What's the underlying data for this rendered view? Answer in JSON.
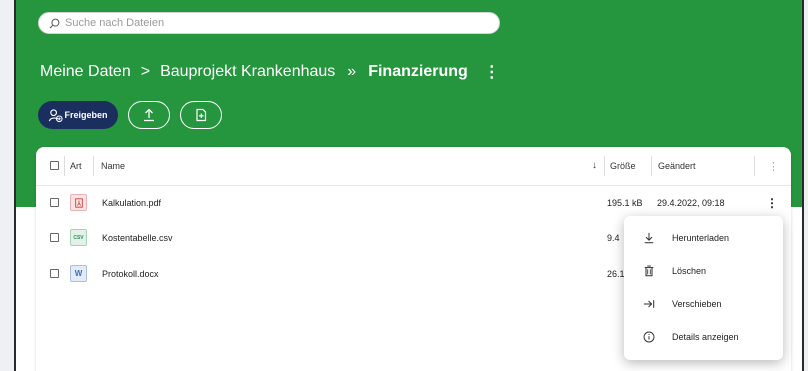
{
  "search": {
    "placeholder": "Suche nach Dateien"
  },
  "breadcrumb": {
    "root": "Meine Daten",
    "sep1": ">",
    "project": "Bauprojekt Krankenhaus",
    "sep2": "»",
    "current": "Finanzierung",
    "more": "⋮"
  },
  "toolbar": {
    "share_label": "Freigeben"
  },
  "table": {
    "columns": {
      "type": "Art",
      "name": "Name",
      "sort_arrow": "↓",
      "size": "Größe",
      "modified": "Geändert",
      "more": "⋮"
    },
    "rows": [
      {
        "name": "Kalkulation.pdf",
        "size": "195.1 kB",
        "modified": "29.4.2022, 09:18",
        "more": "⋮",
        "icon": "pdf-file-icon"
      },
      {
        "name": "Kostentabelle.csv",
        "size": "9.4",
        "modified": "",
        "icon": "csv-file-icon",
        "icon_text": "CSV"
      },
      {
        "name": "Protokoll.docx",
        "size": "26.1",
        "modified": "",
        "icon": "word-file-icon",
        "icon_text": "W"
      }
    ]
  },
  "context_menu": {
    "items": [
      {
        "label": "Herunterladen",
        "icon": "download-icon"
      },
      {
        "label": "Löschen",
        "icon": "trash-icon"
      },
      {
        "label": "Verschieben",
        "icon": "move-icon"
      },
      {
        "label": "Details anzeigen",
        "icon": "info-icon"
      }
    ]
  },
  "colors": {
    "header_green": "#25963e",
    "button_navy": "#1b2f5f",
    "pdf_red": "#c93b3b",
    "csv_green": "#2e8b57",
    "word_blue": "#3f6fb5"
  }
}
